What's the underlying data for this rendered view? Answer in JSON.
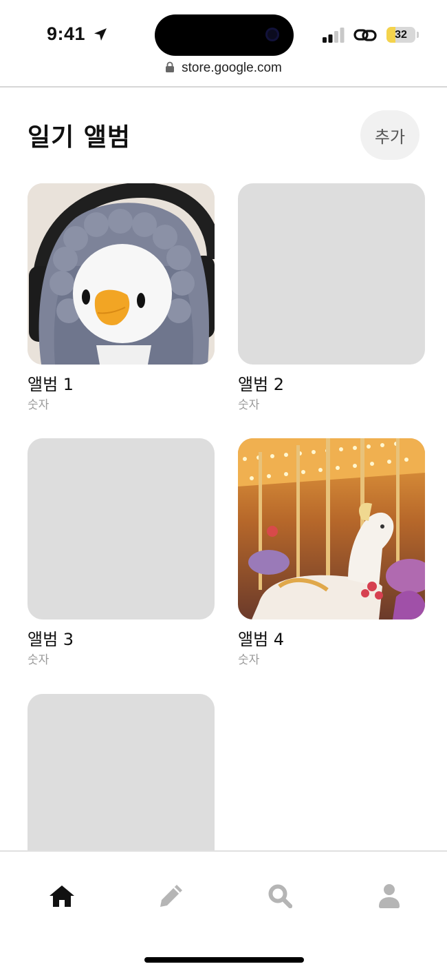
{
  "status_bar": {
    "time": "9:41",
    "battery": "32",
    "battery_level": 0.32,
    "icons": [
      "location-arrow-icon",
      "signal-icon",
      "link-icon",
      "battery-icon"
    ]
  },
  "browser": {
    "url": "store.google.com",
    "icon": "lock-icon"
  },
  "header": {
    "title": "일기 앨범",
    "add_label": "추가"
  },
  "albums": [
    {
      "name": "앨범 1",
      "count": "숫자",
      "has_photo": true,
      "photo": "penguin plush with headphones"
    },
    {
      "name": "앨범 2",
      "count": "숫자",
      "has_photo": false
    },
    {
      "name": "앨범 3",
      "count": "숫자",
      "has_photo": false
    },
    {
      "name": "앨범 4",
      "count": "숫자",
      "has_photo": true,
      "photo": "carousel horse"
    },
    {
      "name": "",
      "count": "",
      "has_photo": false
    }
  ],
  "bottom_nav": {
    "items": [
      {
        "icon": "home-icon",
        "active": true
      },
      {
        "icon": "pencil-icon",
        "active": false
      },
      {
        "icon": "search-icon",
        "active": false
      },
      {
        "icon": "user-icon",
        "active": false
      }
    ]
  },
  "colors": {
    "placeholder": "#dddddd",
    "active_icon": "#111111",
    "inactive_icon": "#b5b5b5",
    "add_button_bg": "#f1f1f1"
  }
}
